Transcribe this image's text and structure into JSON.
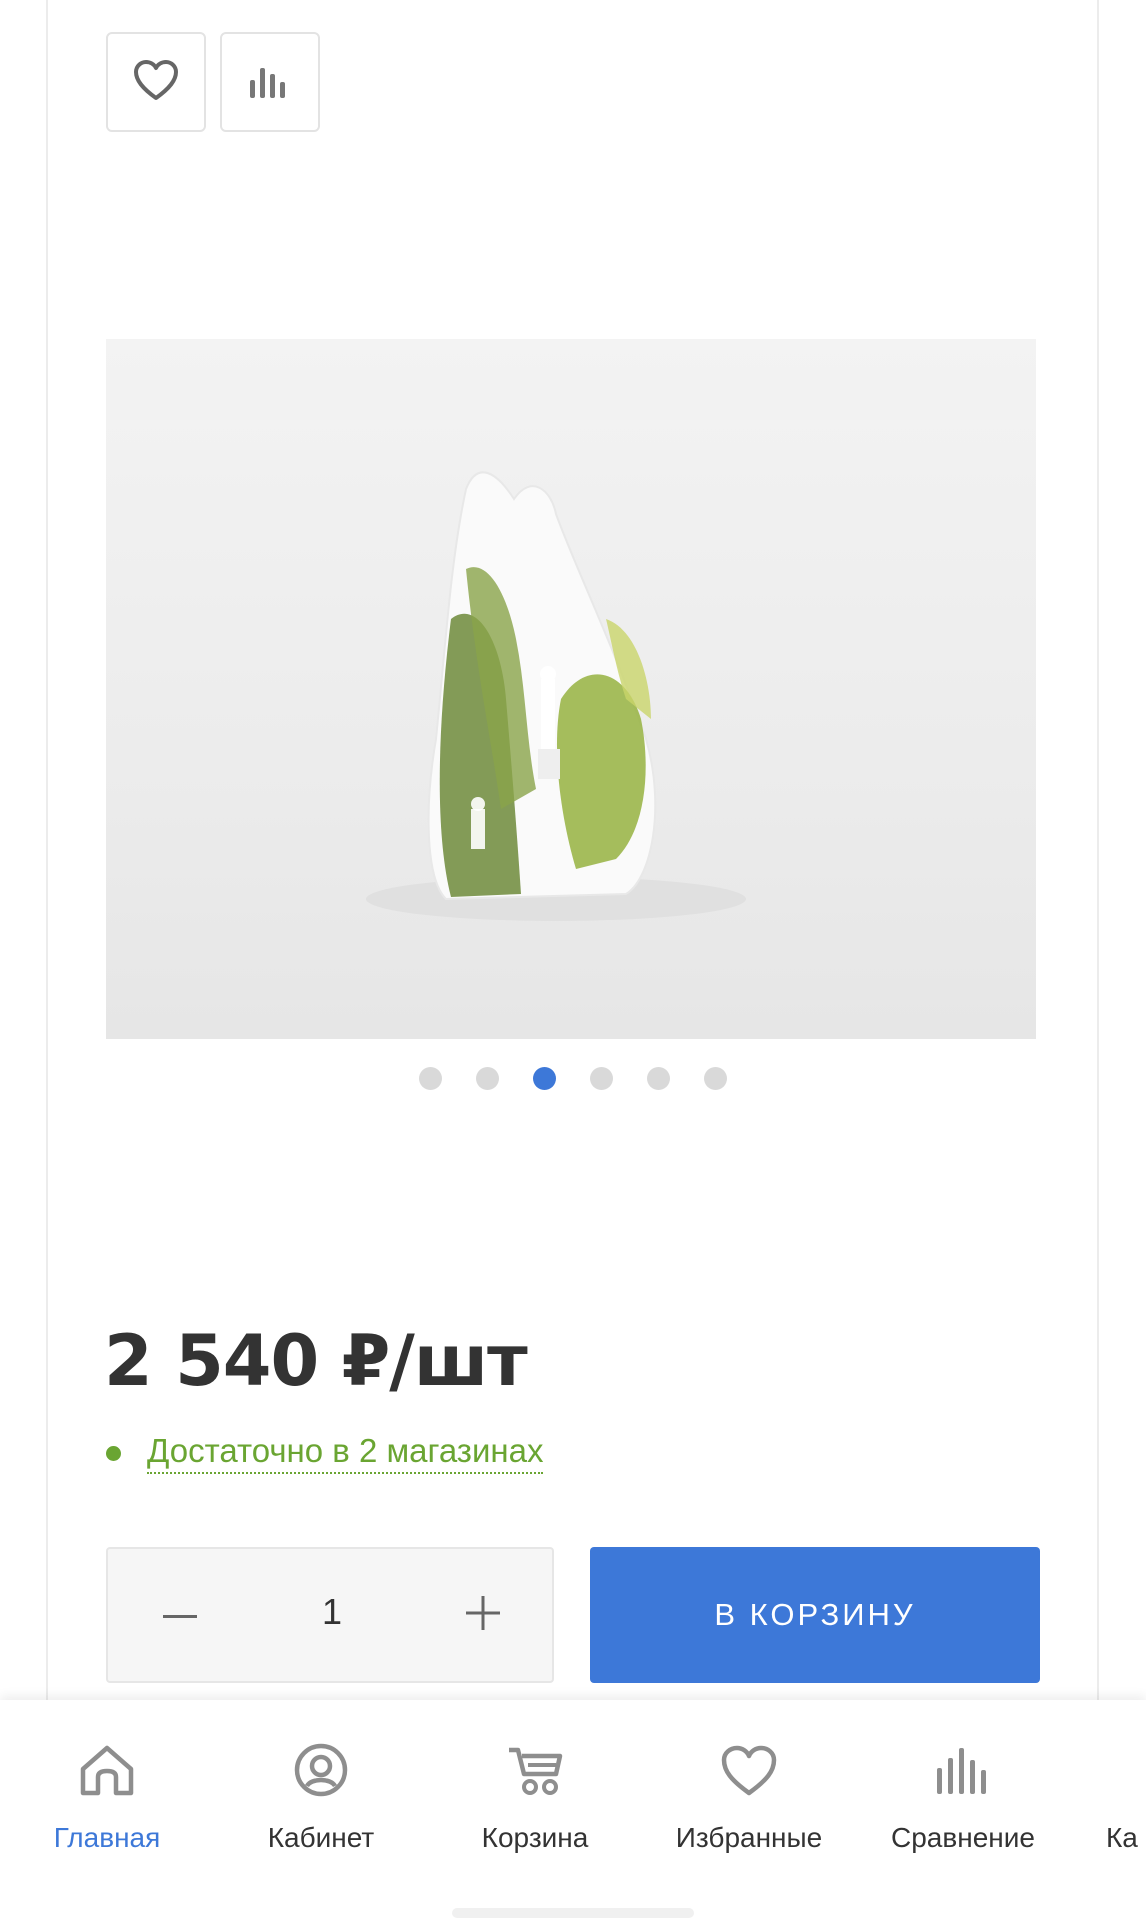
{
  "actions": {
    "favorite_icon": "heart-icon",
    "compare_icon": "bar-chart-icon"
  },
  "gallery": {
    "image_alt_hint": "porcelain-figurine-icon",
    "dots_total": 6,
    "active_dot_index": 2
  },
  "product": {
    "price": "2 540 ₽/шт",
    "stock_text": "Достаточно в 2 магазинах",
    "stock_color": "#6aa532"
  },
  "quantity": {
    "minus_icon": "minus-icon",
    "value": "1",
    "plus_icon": "plus-icon"
  },
  "cart_button": {
    "label": "В КОРЗИНУ",
    "color": "#3d78d8"
  },
  "bottom_nav": {
    "items": [
      {
        "label": "Главная",
        "icon": "home-icon",
        "active": true
      },
      {
        "label": "Кабинет",
        "icon": "user-circle-icon",
        "active": false
      },
      {
        "label": "Корзина",
        "icon": "cart-icon",
        "active": false
      },
      {
        "label": "Избранные",
        "icon": "heart-icon",
        "active": false
      },
      {
        "label": "Сравнение",
        "icon": "bar-chart-icon",
        "active": false
      },
      {
        "label": "Ка",
        "icon": "",
        "active": false
      }
    ],
    "active_color": "#3d78d8"
  }
}
